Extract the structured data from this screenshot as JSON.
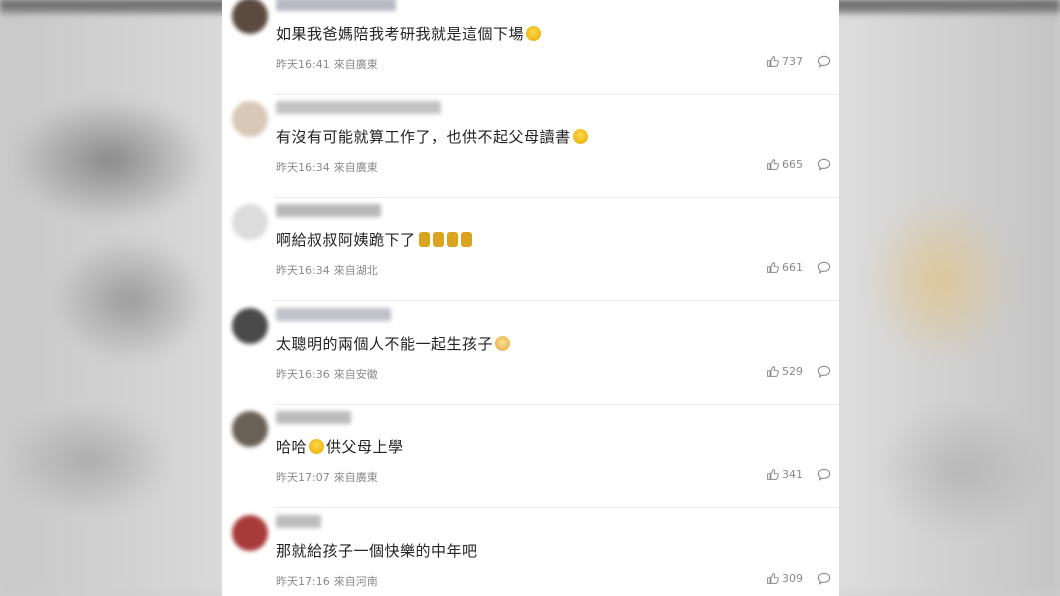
{
  "comments": [
    {
      "text": "如果我爸媽陪我考研我就是這個下場",
      "emoji": "crying-emoji",
      "time": "昨天16:41",
      "location": "來自廣東",
      "likes": "737",
      "avatar_color": "#5a4a40",
      "name_color": "#b9b9c6"
    },
    {
      "text": "有沒有可能就算工作了，也供不起父母讀書",
      "emoji": "laughing-emoji",
      "time": "昨天16:34",
      "location": "來自廣東",
      "likes": "665",
      "avatar_color": "#d8c8b8",
      "name_color": "#c3c3c3"
    },
    {
      "text": "啊給叔叔阿姨跪下了",
      "emoji": "kneeling-emoji",
      "time": "昨天16:34",
      "location": "來自湖北",
      "likes": "661",
      "avatar_color": "#dcdcdc",
      "name_color": "#b8b8b8"
    },
    {
      "text": "太聰明的兩個人不能一起生孩子",
      "emoji": "pig-emoji",
      "time": "昨天16:36",
      "location": "來自安徽",
      "likes": "529",
      "avatar_color": "#4a4a4a",
      "name_color": "#c0c0c8"
    },
    {
      "text_before": "哈哈",
      "text": "供父母上學",
      "emoji": "laughing-emoji",
      "time": "昨天17:07",
      "location": "來自廣東",
      "likes": "341",
      "avatar_color": "#6a6056",
      "name_color": "#bcbcbc"
    },
    {
      "text": "那就給孩子一個快樂的中年吧",
      "emoji": "",
      "time": "昨天17:16",
      "location": "來自河南",
      "likes": "309",
      "avatar_color": "#a83a3a",
      "name_color": "#bdbdbd"
    }
  ]
}
